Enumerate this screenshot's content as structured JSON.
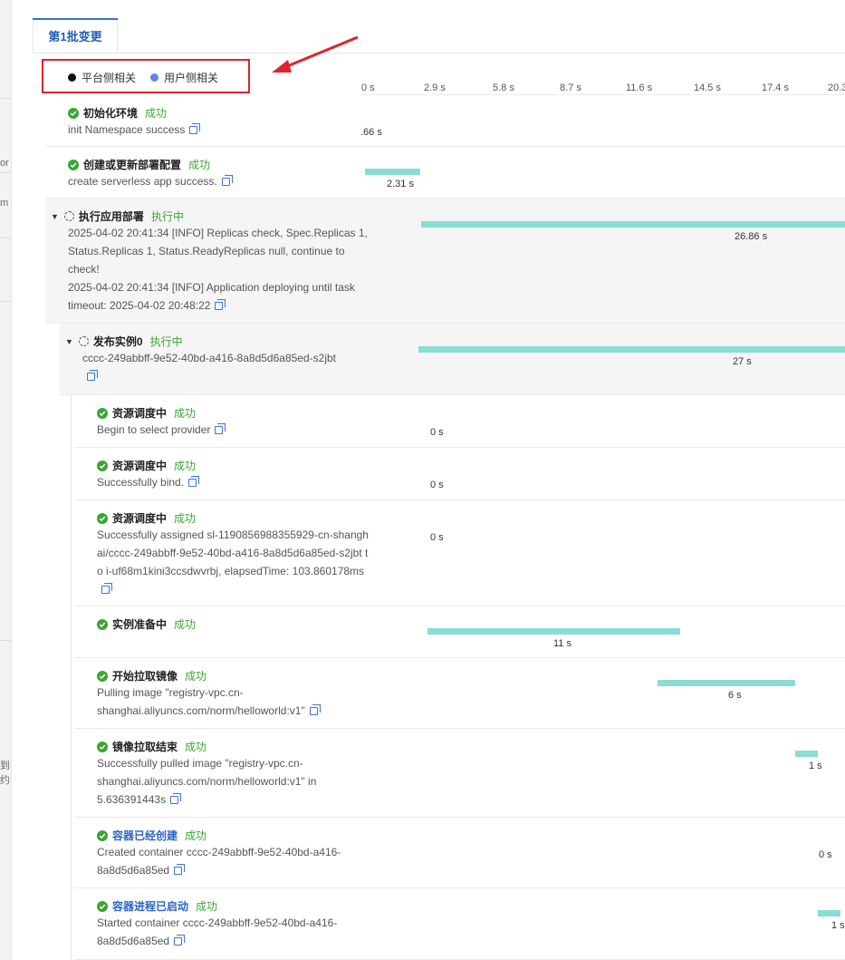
{
  "tab": {
    "label": "第1批变更"
  },
  "legend": {
    "items": [
      {
        "label": "平台侧相关",
        "color": "#111111"
      },
      {
        "label": "用户侧相关",
        "color": "#5b86e6"
      }
    ]
  },
  "axis": {
    "ticks": [
      "0 s",
      "2.9 s",
      "5.8 s",
      "8.7 s",
      "11.6 s",
      "14.5 s",
      "17.4 s",
      "20.3"
    ]
  },
  "left_strip": {
    "texts": [
      "or",
      "m",
      "到约"
    ]
  },
  "steps": [
    {
      "title": "初始化环境",
      "status": "成功",
      "desc": "init Namespace success",
      "duration": ".66 s"
    },
    {
      "title": "创建或更新部署配置",
      "status": "成功",
      "desc": "create serverless app success.",
      "duration": "2.31 s"
    },
    {
      "title": "执行应用部署",
      "status": "执行中",
      "desc": "2025-04-02 20:41:34 [INFO] Replicas check, Spec.Replicas 1, Status.Replicas 1, Status.ReadyReplicas null, continue to check!\n2025-04-02 20:41:34 [INFO] Application deploying until task timeout: 2025-04-02 20:48:22",
      "duration": "26.86 s"
    },
    {
      "title": "发布实例0",
      "status": "执行中",
      "desc": "cccc-249abbff-9e52-40bd-a416-8a8d5d6a85ed-s2jbt",
      "duration": "27 s"
    },
    {
      "title": "资源调度中",
      "status": "成功",
      "desc": "Begin to select provider",
      "duration": "0 s"
    },
    {
      "title": "资源调度中",
      "status": "成功",
      "desc": "Successfully bind.",
      "duration": "0 s"
    },
    {
      "title": "资源调度中",
      "status": "成功",
      "desc": "Successfully assigned sl-1190856988355929-cn-shanghai/cccc-249abbff-9e52-40bd-a416-8a8d5d6a85ed-s2jbt to i-uf68m1kini3ccsdwvrbj, elapsedTime: 103.860178ms",
      "duration": "0 s"
    },
    {
      "title": "实例准备中",
      "status": "成功",
      "desc": "",
      "duration": "11 s"
    },
    {
      "title": "开始拉取镜像",
      "status": "成功",
      "desc": "Pulling image \"registry-vpc.cn-shanghai.aliyuncs.com/norm/helloworld:v1\"",
      "duration": "6 s"
    },
    {
      "title": "镜像拉取结束",
      "status": "成功",
      "desc": "Successfully pulled image \"registry-vpc.cn-shanghai.aliyuncs.com/norm/helloworld:v1\" in 5.636391443s",
      "duration": "1 s"
    },
    {
      "title": "容器已经创建",
      "status": "成功",
      "desc": "Created container cccc-249abbff-9e52-40bd-a416-8a8d5d6a85ed",
      "duration": "0 s"
    },
    {
      "title": "容器进程已启动",
      "status": "成功",
      "desc": "Started container cccc-249abbff-9e52-40bd-a416-8a8d5d6a85ed",
      "duration": "1 s"
    }
  ]
}
